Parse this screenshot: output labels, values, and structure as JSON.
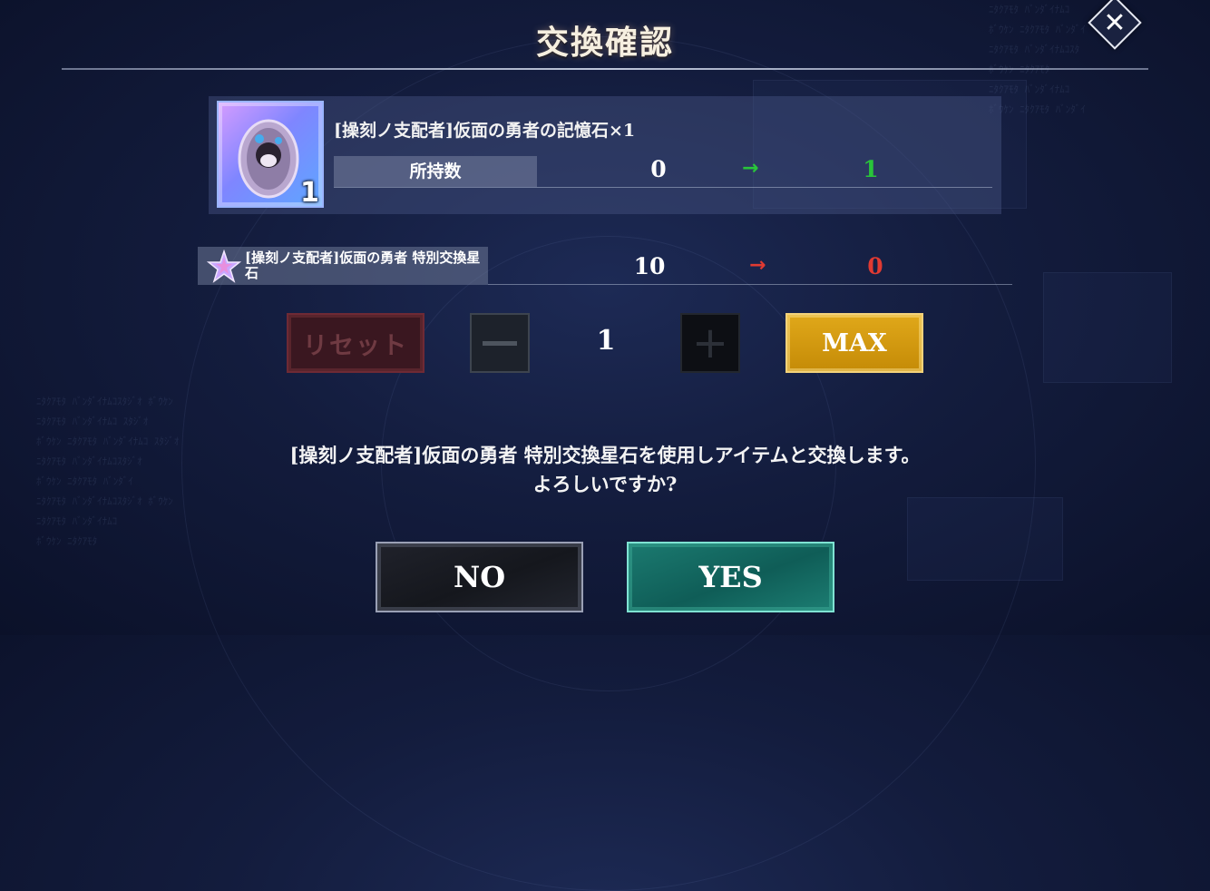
{
  "dialog": {
    "title": "交換確認",
    "close_icon": "close-icon"
  },
  "item": {
    "name": "[操刻ノ支配者]仮面の勇者の記憶石×1",
    "thumb_count": "1",
    "owned_label": "所持数",
    "owned_before": "0",
    "owned_after": "1",
    "gain_color": "#29c53a"
  },
  "cost": {
    "name": "[操刻ノ支配者]仮面の勇者 特別交換星石",
    "icon": "star-stone-icon",
    "before": "10",
    "after": "0",
    "loss_color": "#e03a32"
  },
  "quantity": {
    "reset_label": "リセット",
    "value": "1",
    "max_label": "MAX"
  },
  "message": {
    "line1": "[操刻ノ支配者]仮面の勇者 特別交換星石を使用しアイテムと交換します。",
    "line2": "よろしいですか?"
  },
  "buttons": {
    "no_label": "NO",
    "yes_label": "YES"
  }
}
